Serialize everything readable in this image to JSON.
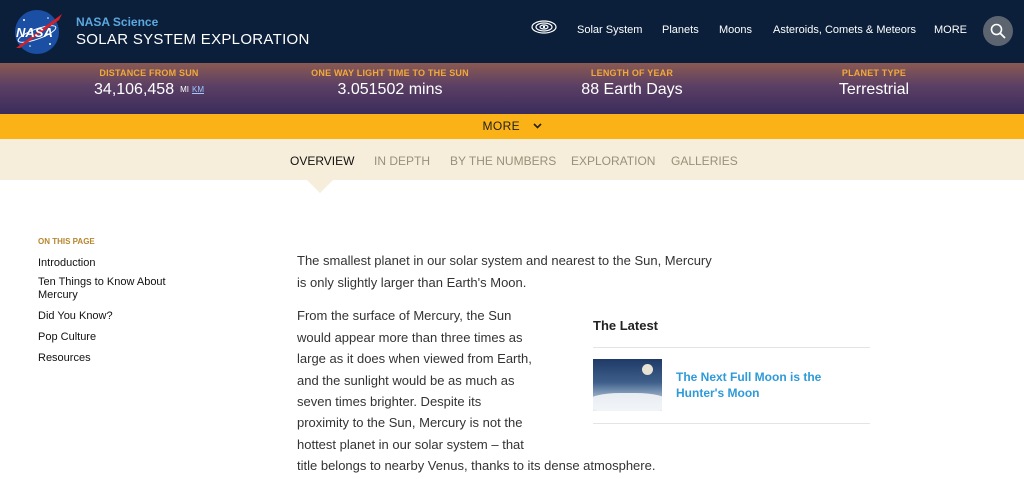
{
  "header": {
    "brand_small": "NASA Science",
    "brand_title": "SOLAR SYSTEM EXPLORATION",
    "logo_text": "NASA",
    "nav": [
      "Solar System",
      "Planets",
      "Moons",
      "Asteroids, Comets & Meteors",
      "MORE"
    ],
    "icons": [
      "galaxy-icon",
      "search-icon"
    ]
  },
  "stats": [
    {
      "label": "DISTANCE FROM SUN",
      "value": "34,106,458",
      "unit_mi": "MI",
      "unit_km": "KM"
    },
    {
      "label": "ONE WAY LIGHT TIME TO THE SUN",
      "value": "3.051502 mins"
    },
    {
      "label": "LENGTH OF YEAR",
      "value": "88 Earth Days"
    },
    {
      "label": "PLANET TYPE",
      "value": "Terrestrial"
    }
  ],
  "more_bar": {
    "label": "MORE"
  },
  "tabs": [
    "OVERVIEW",
    "IN DEPTH",
    "BY THE NUMBERS",
    "EXPLORATION",
    "GALLERIES"
  ],
  "sidebar": {
    "heading": "ON THIS PAGE",
    "items": [
      "Introduction",
      "Ten Things to Know About Mercury",
      "Did You Know?",
      "Pop Culture",
      "Resources"
    ]
  },
  "main": {
    "paragraph1": "The smallest planet in our solar system and nearest to the Sun, Mercury is only slightly larger than Earth's Moon.",
    "paragraph2_lines": [
      "From the surface of Mercury, the Sun",
      "would appear more than three times as",
      "large as it does when viewed from Earth,",
      "and the sunlight would be as much as",
      "seven times brighter. Despite its",
      "proximity to the Sun, Mercury is not the",
      "hottest planet in our solar system – that",
      "title belongs to nearby Venus, thanks to its dense atmosphere."
    ]
  },
  "latest": {
    "title": "The Latest",
    "article": "The Next Full Moon is the Hunter's Moon"
  },
  "colors": {
    "header_bg": "#0b1f3a",
    "accent_orange": "#fbb216",
    "stat_label": "#f2a93b",
    "link_blue": "#2e9ad9",
    "tab_bg": "#f6eedb"
  }
}
